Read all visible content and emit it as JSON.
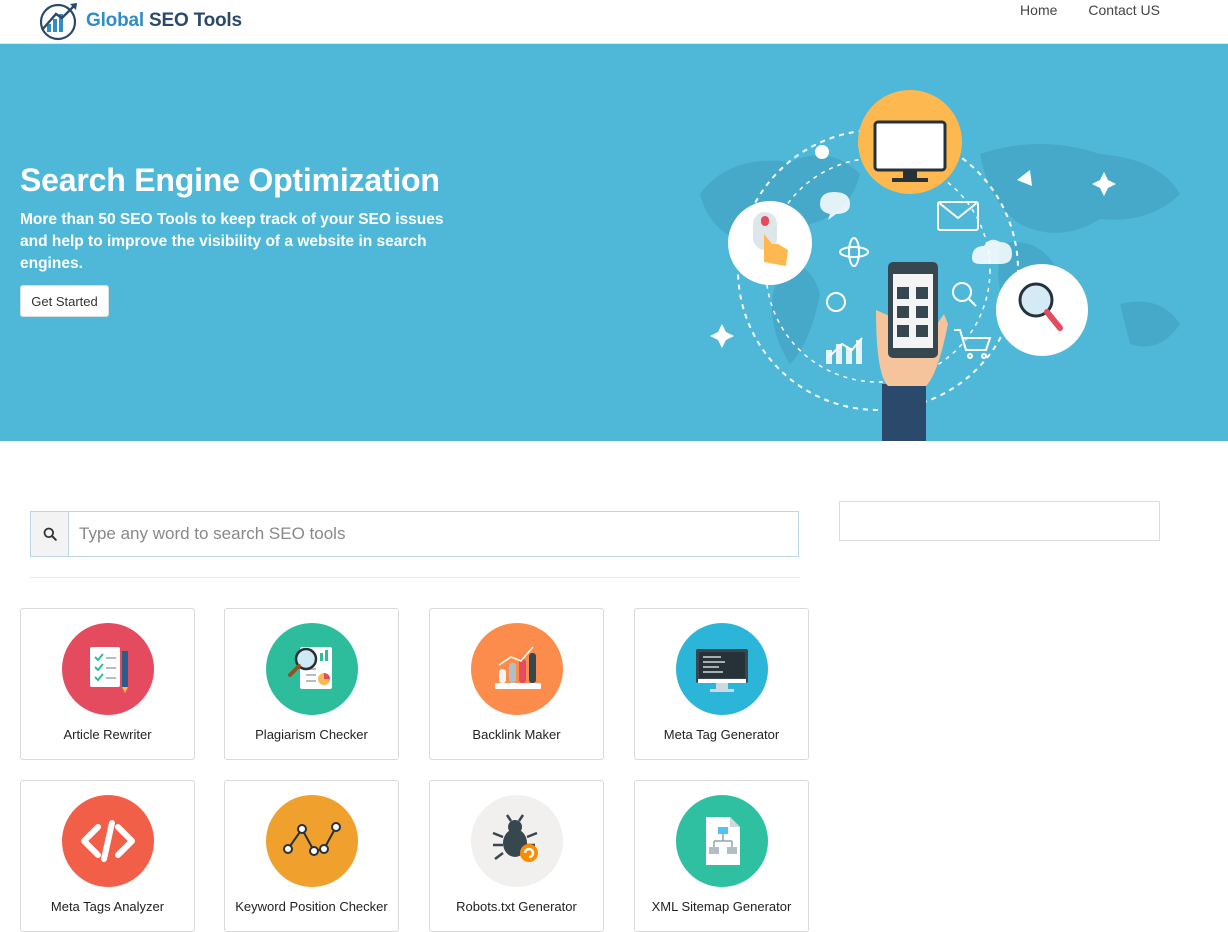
{
  "header": {
    "logo_brand": "Global ",
    "logo_highlight": "SEO Tools",
    "nav": [
      {
        "label": "Home"
      },
      {
        "label": "Contact US"
      }
    ]
  },
  "hero": {
    "title": "Search Engine Optimization",
    "subtitle": "More than 50 SEO Tools to keep track of your SEO issues and help to improve the visibility of a website in search engines.",
    "cta_label": "Get Started",
    "background_color": "#4fb8d8"
  },
  "search": {
    "placeholder": "Type any word to search SEO tools",
    "value": "",
    "icon": "search-icon"
  },
  "tools": [
    {
      "label": "Article Rewriter",
      "icon": "document-checklist-icon",
      "color": "#e54b5e"
    },
    {
      "label": "Plagiarism Checker",
      "icon": "magnifier-report-icon",
      "color": "#2dbd9d"
    },
    {
      "label": "Backlink Maker",
      "icon": "bar-chart-icon",
      "color": "#fb8c4c"
    },
    {
      "label": "Meta Tag Generator",
      "icon": "code-monitor-icon",
      "color": "#2bb5d8"
    },
    {
      "label": "Meta Tags Analyzer",
      "icon": "code-brackets-icon",
      "color": "#f25f49"
    },
    {
      "label": "Keyword Position Checker",
      "icon": "line-graph-icon",
      "color": "#f0a02c"
    },
    {
      "label": "Robots.txt Generator",
      "icon": "bug-icon",
      "color": "#f2f0ee"
    },
    {
      "label": "XML Sitemap Generator",
      "icon": "sitemap-file-icon",
      "color": "#2ec0a0"
    }
  ]
}
